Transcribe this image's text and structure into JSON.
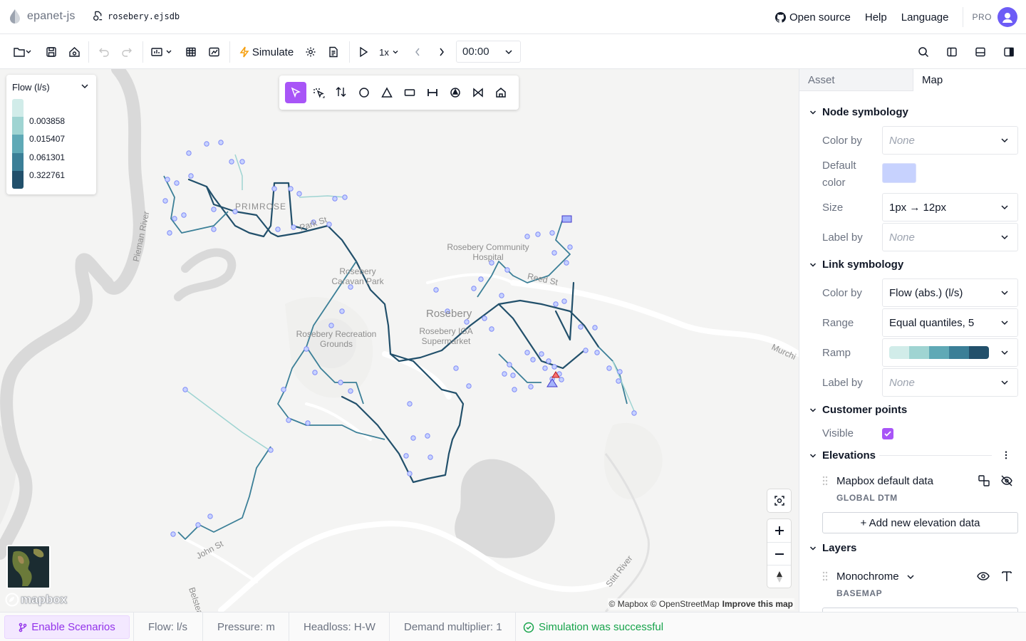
{
  "app": {
    "name": "epanet-js",
    "file_name": "rosebery.ejsdb"
  },
  "header": {
    "open_source": "Open source",
    "help": "Help",
    "language": "Language",
    "pro": "PRO"
  },
  "toolbar": {
    "simulate": "Simulate",
    "speed": "1x",
    "time": "00:00"
  },
  "legend": {
    "title": "Flow (l/s)",
    "values": [
      "0.003858",
      "0.015407",
      "0.061301",
      "0.322761"
    ],
    "colors": [
      "#d1ece9",
      "#9fd4d2",
      "#5fa9b6",
      "#3b7f97",
      "#22506b"
    ]
  },
  "map": {
    "labels": {
      "primrose": "PRIMROSE",
      "park_st": "Park St",
      "hospital": "Rosebery Community Hospital",
      "caravan": "Rosebery Caravan Park",
      "rosebery": "Rosebery",
      "recreation": "Rosebery Recreation Grounds",
      "supermarket": "Rosebery IGA Supermarket",
      "reed_st": "Reed St",
      "pieman": "Pieman River",
      "john_st": "John St",
      "stitt": "Stitt River",
      "murchison": "Murchi",
      "belstead": "Belstea"
    },
    "attribution": "© Mapbox © OpenStreetMap",
    "improve": "Improve this map",
    "mapbox_logo": "mapbox"
  },
  "panel": {
    "tabs": [
      "Asset",
      "Map"
    ],
    "node_symbology": {
      "title": "Node symbology",
      "color_by_label": "Color by",
      "color_by": "None",
      "default_color_label_1": "Default",
      "default_color_label_2": "color",
      "default_color": "#c7d2fe",
      "size_label": "Size",
      "size": "1px → 12px",
      "label_by_label": "Label by",
      "label_by": "None"
    },
    "link_symbology": {
      "title": "Link symbology",
      "color_by_label": "Color by",
      "color_by": "Flow (abs.) (l/s)",
      "range_label": "Range",
      "range": "Equal quantiles, 5",
      "ramp_label": "Ramp",
      "label_by_label": "Label by",
      "label_by": "None"
    },
    "customer_points": {
      "title": "Customer points",
      "visible_label": "Visible",
      "visible": true
    },
    "elevations": {
      "title": "Elevations",
      "item_title": "Mapbox default data",
      "item_sub": "GLOBAL DTM",
      "add_button": "+ Add new elevation data"
    },
    "layers": {
      "title": "Layers",
      "item_title": "Monochrome",
      "item_sub": "BASEMAP"
    }
  },
  "footer": {
    "enable_scenarios": "Enable Scenarios",
    "flow": "Flow: l/s",
    "pressure": "Pressure: m",
    "headloss": "Headloss: H-W",
    "demand": "Demand multiplier: 1",
    "status": "Simulation was successful"
  },
  "colors": {
    "accent": "#a855f7",
    "success": "#16a34a"
  }
}
